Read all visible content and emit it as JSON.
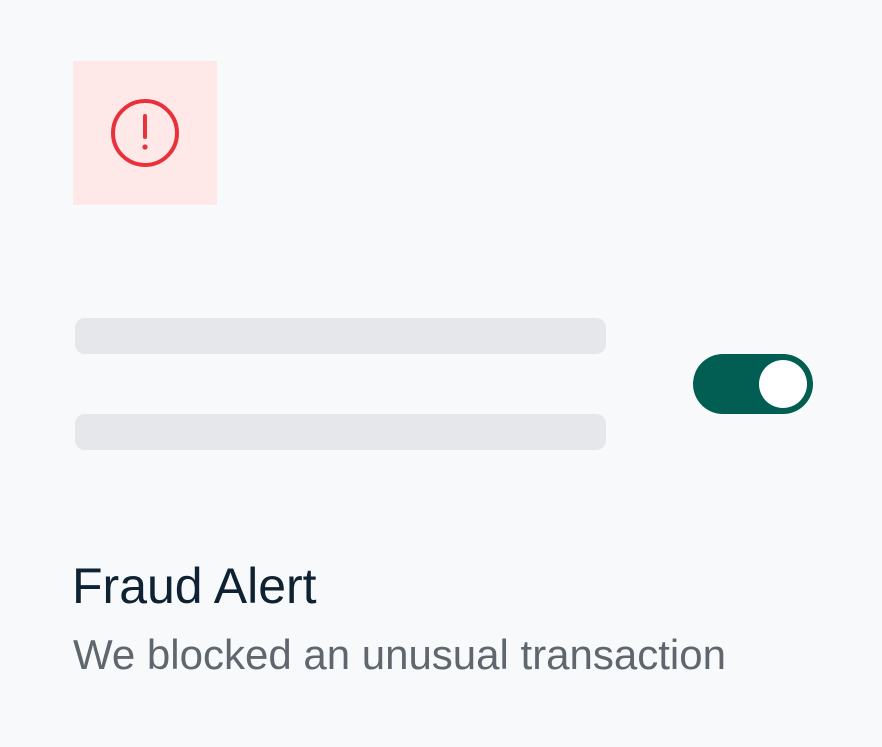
{
  "alert": {
    "title": "Fraud Alert",
    "subtitle": "We blocked an unusual transaction",
    "icon": "alert-circle-icon",
    "icon_color": "#e8313b",
    "icon_background": "#ffe9e8"
  },
  "toggle": {
    "state": "on",
    "track_color": "#025d52",
    "knob_color": "#ffffff"
  },
  "colors": {
    "background": "#f8f9fb",
    "skeleton": "#e6e7ea",
    "title": "#0f2233",
    "subtitle": "#5f666e"
  }
}
